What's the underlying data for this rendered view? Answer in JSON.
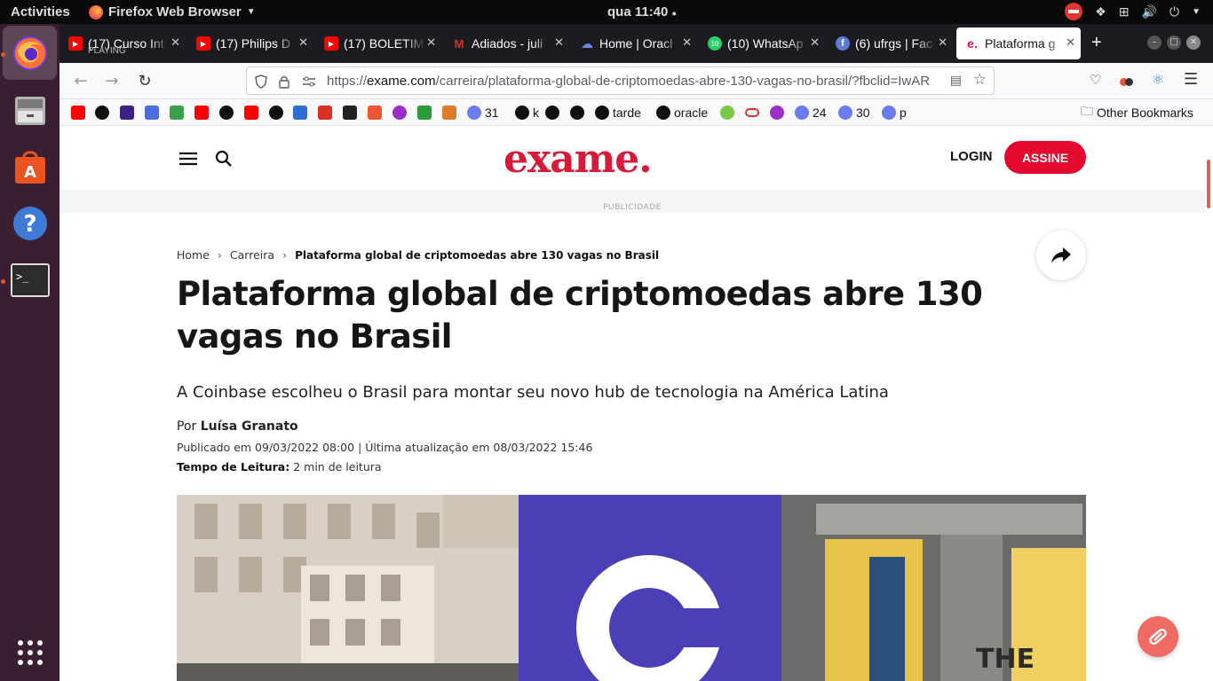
{
  "system": {
    "activities_label": "Activities",
    "app_name": "Firefox Web Browser",
    "clock": "qua 11:40"
  },
  "tabs": [
    {
      "title": "(17) Curso Int",
      "subtitle": "PLAYING",
      "icon": "youtube-icon"
    },
    {
      "title": "(17) Philips D",
      "icon": "youtube-icon"
    },
    {
      "title": "(17) BOLETIM",
      "icon": "youtube-icon"
    },
    {
      "title": "Adiados - juli",
      "icon": "gmail-icon"
    },
    {
      "title": "Home | Oracl",
      "icon": "oracle-cloud-icon"
    },
    {
      "title": "(10) WhatsAp",
      "icon": "whatsapp-icon"
    },
    {
      "title": "(6) ufrgs | Fac",
      "icon": "facebook-icon"
    },
    {
      "title": "Plataforma g",
      "icon": "exame-icon",
      "selected": true
    }
  ],
  "address_bar": {
    "url_prefix": "https://",
    "url_domain": "exame.com",
    "url_path": "/carreira/plataforma-global-de-criptomoedas-abre-130-vagas-no-brasil/?fbclid=IwAR"
  },
  "bookmarks": [
    {
      "label": "",
      "icon": "youtube-icon"
    },
    {
      "label": "",
      "icon": "github-icon"
    },
    {
      "label": "",
      "icon": "analytics-icon"
    },
    {
      "label": "",
      "icon": "play-icon"
    },
    {
      "label": "",
      "icon": "leaf-icon"
    },
    {
      "label": "",
      "icon": "youtube-icon"
    },
    {
      "label": "",
      "icon": "github-icon"
    },
    {
      "label": "",
      "icon": "youtube-icon"
    },
    {
      "label": "",
      "icon": "github-icon"
    },
    {
      "label": "",
      "icon": "trello-icon"
    },
    {
      "label": "",
      "icon": "gmail-icon"
    },
    {
      "label": "",
      "icon": "graph-icon"
    },
    {
      "label": "",
      "icon": "rocket-icon"
    },
    {
      "label": "",
      "icon": "ufrgs-icon"
    },
    {
      "label": "",
      "icon": "brazil-flag-icon"
    },
    {
      "label": "",
      "icon": "box-icon"
    },
    {
      "label": "31",
      "icon": "moon-icon"
    },
    {
      "label": "k",
      "icon": "github-icon"
    },
    {
      "label": "",
      "icon": "github-icon"
    },
    {
      "label": "",
      "icon": "github-icon"
    },
    {
      "label": "tarde",
      "icon": "github-icon"
    },
    {
      "label": "oracle",
      "icon": "github-icon"
    },
    {
      "label": "",
      "icon": "smiley-icon"
    },
    {
      "label": "",
      "icon": "oracle-icon"
    },
    {
      "label": "",
      "icon": "ufrgs-icon"
    },
    {
      "label": "24",
      "icon": "moon-icon"
    },
    {
      "label": "30",
      "icon": "moon-icon"
    },
    {
      "label": "p",
      "icon": "moon-icon"
    }
  ],
  "other_bookmarks": "Other Bookmarks",
  "site": {
    "logo": "exame.",
    "login": "LOGIN",
    "subscribe": "ASSINE",
    "ad_label": "PUBLICIDADE"
  },
  "breadcrumb": {
    "home": "Home",
    "section": "Carreira",
    "current": "Plataforma global de criptomoedas abre 130 vagas no Brasil"
  },
  "article": {
    "title": "Plataforma global de criptomoedas abre 130 vagas no Brasil",
    "subtitle": "A Coinbase escolheu o Brasil para montar seu novo hub de tecnologia na América Latina",
    "author_prefix": "Por",
    "author": "Luísa Granato",
    "dates": "Publicado em 09/03/2022 08:00 | Última atualização em 08/03/2022 15:46",
    "read_time_label": "Tempo de Leitura:",
    "read_time": "2 min de leitura"
  },
  "colors": {
    "brand": "#d51a3a",
    "subscribe_button": "#e3092e",
    "coinbase_blue": "#4b3fb8"
  }
}
